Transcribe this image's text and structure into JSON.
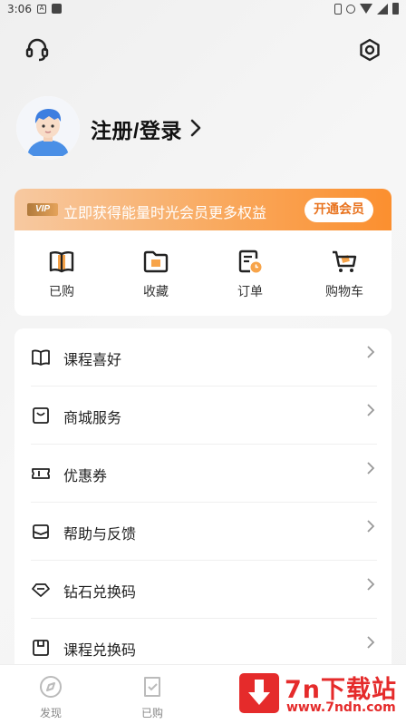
{
  "status_bar": {
    "time": "3:06",
    "notif_icon_letter": "A"
  },
  "header": {
    "support_icon": "headset-icon",
    "settings_icon": "gear-icon"
  },
  "profile": {
    "login_label": "注册/登录",
    "avatar_icon": "user-avatar-icon"
  },
  "vip": {
    "badge": "VIP",
    "promo_text": "立即获得能量时光会员更多权益",
    "button_label": "开通会员",
    "gradient_colors": [
      "#f7c9a1",
      "#f9a95e",
      "#fb8f2f"
    ]
  },
  "quick_actions": [
    {
      "label": "已购",
      "icon": "book-icon"
    },
    {
      "label": "收藏",
      "icon": "folder-icon"
    },
    {
      "label": "订单",
      "icon": "order-icon"
    },
    {
      "label": "购物车",
      "icon": "cart-icon"
    }
  ],
  "menu": [
    {
      "label": "课程喜好",
      "icon": "open-book-icon"
    },
    {
      "label": "商城服务",
      "icon": "shopping-bag-icon"
    },
    {
      "label": "优惠券",
      "icon": "ticket-icon"
    },
    {
      "label": "帮助与反馈",
      "icon": "mail-icon"
    },
    {
      "label": "钻石兑换码",
      "icon": "diamond-icon"
    },
    {
      "label": "课程兑换码",
      "icon": "save-disk-icon"
    }
  ],
  "tabbar": [
    {
      "label": "发现",
      "icon": "compass-icon"
    },
    {
      "label": "已购",
      "icon": "purchased-icon"
    }
  ],
  "watermark": {
    "title": "7n下载站",
    "url": "www.7ndn.com"
  },
  "colors": {
    "accent_orange": "#fb8f2f",
    "icon_dark": "#222222",
    "icon_orange_fill": "#f7a44a",
    "watermark_red": "#e52b2b"
  }
}
